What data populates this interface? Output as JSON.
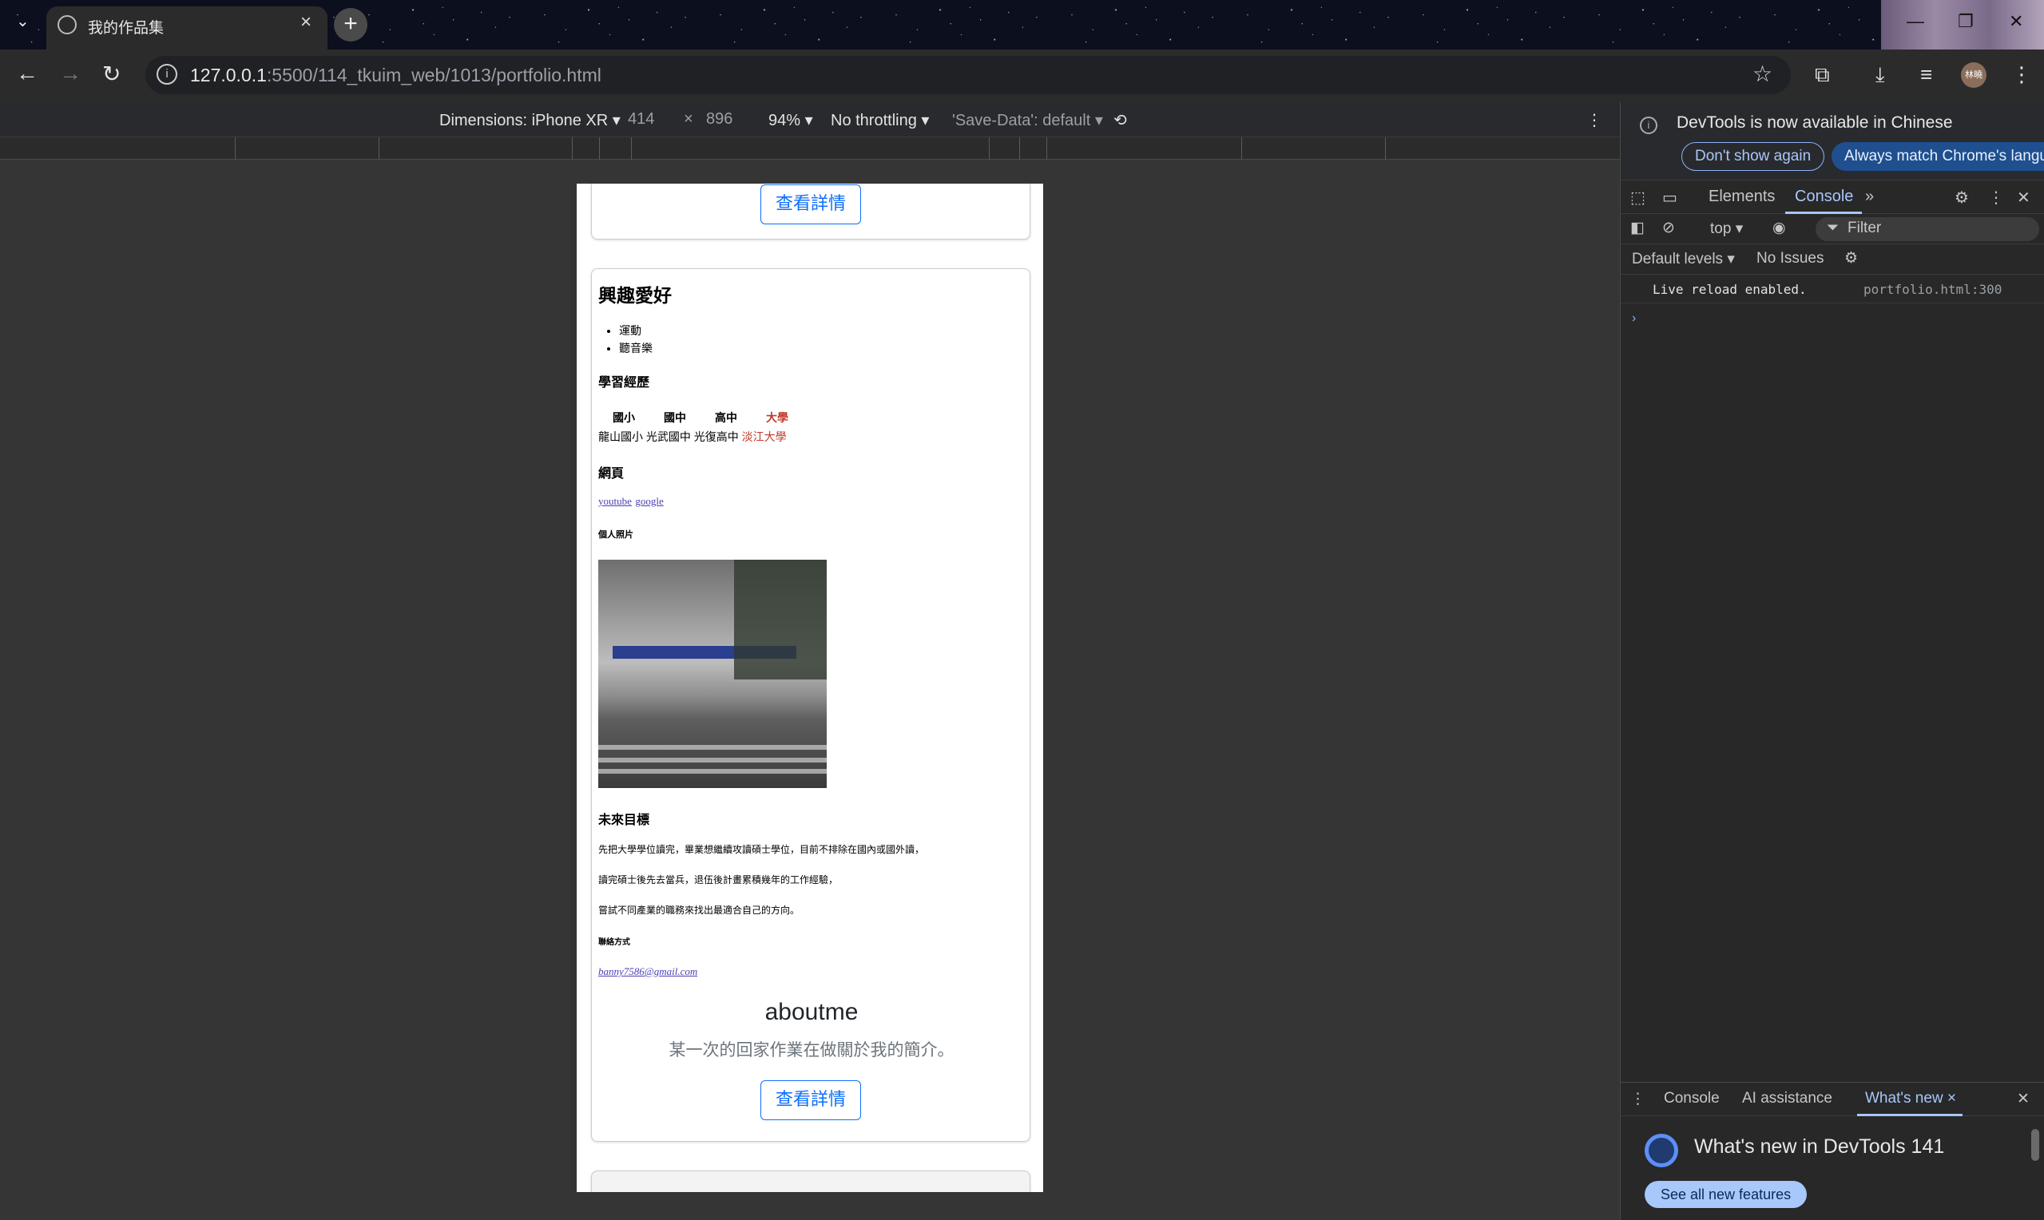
{
  "browser": {
    "tab_title": "我的作品集",
    "url_host": "127.0.0.1",
    "url_rest": ":5500/114_tkuim_web/1013/portfolio.html",
    "avatar_text": "林曉"
  },
  "device_toolbar": {
    "dimensions_label": "Dimensions: iPhone XR",
    "width": "414",
    "times": "×",
    "height": "896",
    "zoom": "94%",
    "throttling": "No throttling",
    "save_data": "'Save-Data': default"
  },
  "page": {
    "top_button": "查看詳情",
    "hobby_title": "興趣愛好",
    "hobbies": [
      "運動",
      "聽音樂"
    ],
    "edu_title": "學習經歷",
    "edu_headers": [
      "國小",
      "國中",
      "高中",
      "大學"
    ],
    "edu_values": [
      "龍山國小",
      "光武國中",
      "光復高中",
      "淡江大學"
    ],
    "web_title": "網頁",
    "links": [
      "youtube",
      "google"
    ],
    "photo_title": "個人照片",
    "goal_title": "未來目標",
    "goal_lines": [
      "先把大學學位讀完，畢業想繼續攻讀碩士學位，目前不排除在國內或國外讀，",
      "讀完碩士後先去當兵，退伍後計畫累積幾年的工作經驗，",
      "嘗試不同產業的職務來找出最適合自己的方向。"
    ],
    "contact_title": "聯絡方式",
    "email": "banny7586@gmail.com",
    "about_title": "aboutme",
    "about_sub": "某一次的回家作業在做關於我的簡介。",
    "about_button": "查看詳情"
  },
  "devtools": {
    "notice": "DevTools is now available in Chinese",
    "btn_dont": "Don't show again",
    "btn_always": "Always match Chrome's language",
    "tabs": [
      "Elements",
      "Console"
    ],
    "context": "top",
    "filter_placeholder": "Filter",
    "levels": "Default levels",
    "issues": "No Issues",
    "console_message": "Live reload enabled.",
    "console_source": "portfolio.html:300",
    "drawer_tabs": [
      "Console",
      "AI assistance",
      "What's new"
    ],
    "whats_new_title": "What's new in DevTools 141",
    "see_all": "See all new features"
  }
}
